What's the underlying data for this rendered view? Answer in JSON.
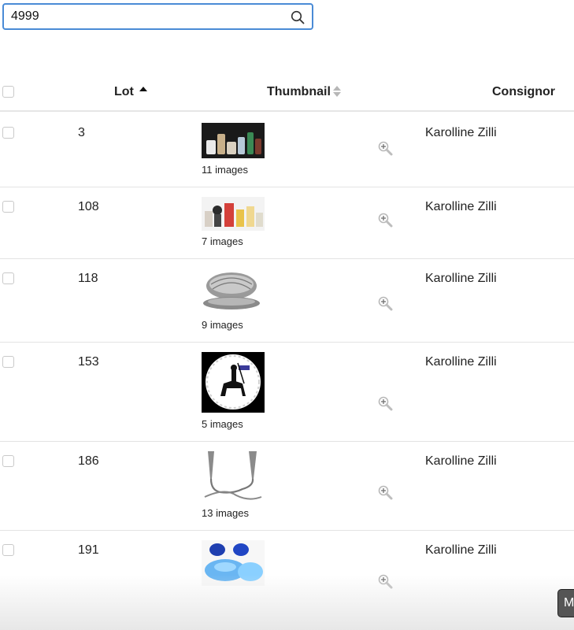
{
  "search": {
    "value": "4999",
    "icon": "search-icon"
  },
  "table": {
    "columns": {
      "lot": "Lot",
      "thumbnail": "Thumbnail",
      "consignor": "Consignor"
    },
    "rows": [
      {
        "lot": "3",
        "images": "11 images",
        "consignor": "Karolline Zilli"
      },
      {
        "lot": "108",
        "images": "7 images",
        "consignor": "Karolline Zilli"
      },
      {
        "lot": "118",
        "images": "9 images",
        "consignor": "Karolline Zilli"
      },
      {
        "lot": "153",
        "images": "5 images",
        "consignor": "Karolline Zilli"
      },
      {
        "lot": "186",
        "images": "13 images",
        "consignor": "Karolline Zilli"
      },
      {
        "lot": "191",
        "images": "",
        "consignor": "Karolline Zilli"
      }
    ]
  },
  "corner_button": {
    "label": "M"
  }
}
